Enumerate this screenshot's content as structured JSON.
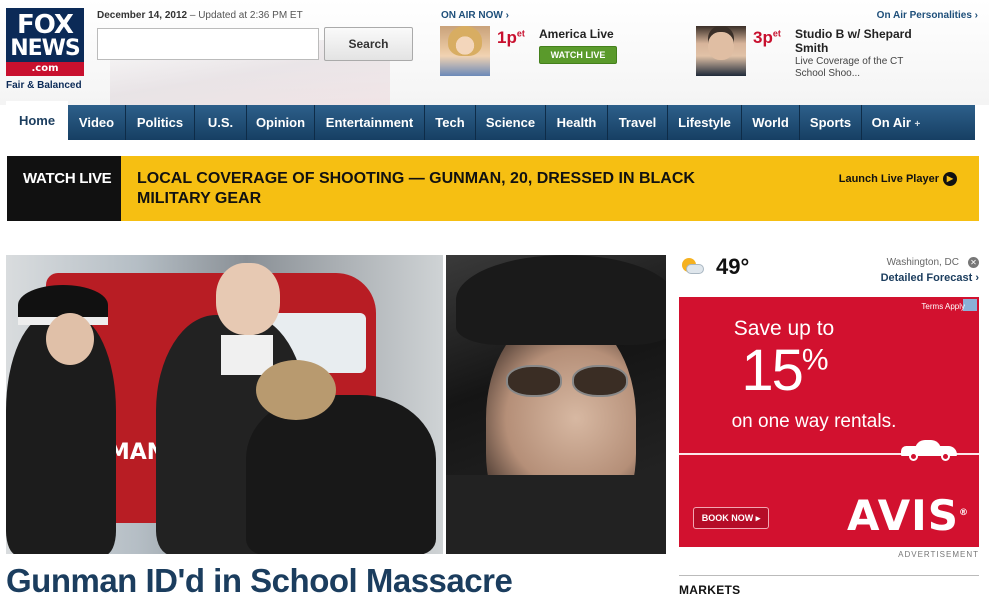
{
  "header": {
    "logo": {
      "line1": "FOX",
      "line2": "NEWS",
      "domain": ".com",
      "tagline": "Fair & Balanced"
    },
    "date": "December 14, 2012",
    "updated": "– Updated at 2:36 PM ET",
    "search": {
      "value": "",
      "placeholder": "",
      "button": "Search"
    },
    "on_air_now_label": "ON AIR NOW ›",
    "on_air_personalities_label": "On Air Personalities ›",
    "shows": [
      {
        "time": "1p",
        "zone": "et",
        "name": "America Live",
        "button": "WATCH LIVE"
      },
      {
        "time": "3p",
        "zone": "et",
        "name": "Studio B w/ Shepard Smith",
        "desc": "Live Coverage of the CT School Shoo..."
      }
    ]
  },
  "nav": {
    "items": [
      "Home",
      "Video",
      "Politics",
      "U.S.",
      "Opinion",
      "Entertainment",
      "Tech",
      "Science",
      "Health",
      "Travel",
      "Lifestyle",
      "World",
      "Sports",
      "On Air"
    ],
    "plus": "+"
  },
  "banner": {
    "label": "WATCH LIVE",
    "headline": "LOCAL COVERAGE OF SHOOTING — GUNMAN, 20, DRESSED IN BLACK MILITARY GEAR",
    "launch": "Launch Live Player"
  },
  "hero": {
    "headline": "Gunman ID'd in School Massacre",
    "sign_text": "MMAN"
  },
  "weather": {
    "temp": "49°",
    "city": "Washington, DC",
    "forecast": "Detailed Forecast ›",
    "close": "✕"
  },
  "ad": {
    "terms": "Terms Apply",
    "save": "Save up to",
    "percent": "15",
    "percent_sign": "%",
    "sub": "on one way rentals.",
    "book": "BOOK NOW ▸",
    "brand": "AVIS",
    "reg": "®",
    "label": "ADVERTISEMENT"
  },
  "markets": {
    "title": "MARKETS"
  },
  "colors": {
    "nav": "#1f4a72",
    "banner": "#f6bf12",
    "headline": "#1b3d5e",
    "ad": "#d2112f",
    "live": "#c8102e"
  }
}
